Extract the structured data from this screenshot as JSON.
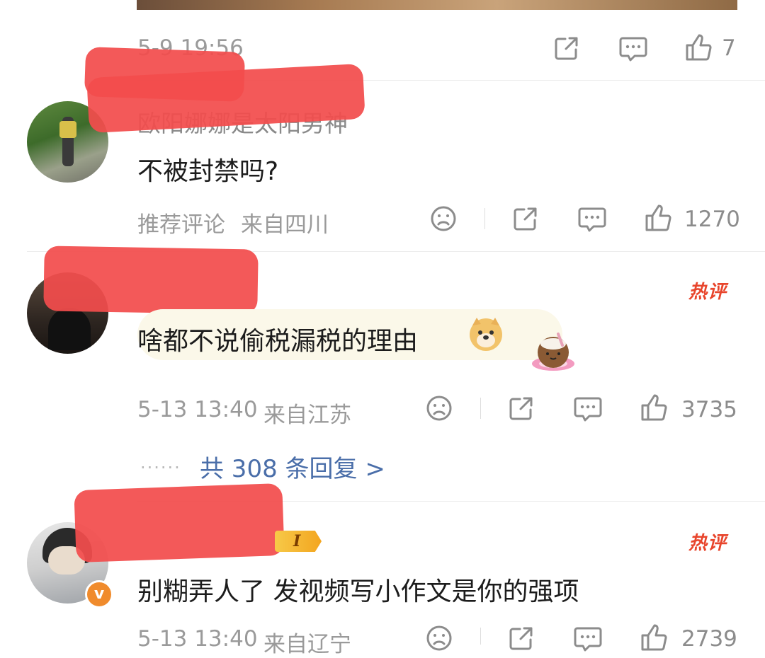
{
  "post": {
    "timestamp": "5-9 19:56",
    "like_count": "7"
  },
  "comments": [
    {
      "username": "欧阳娜娜是太阳男神",
      "text": "不被封禁吗?",
      "tag": "推荐评论",
      "location": "来自四川",
      "like_count": "1270"
    },
    {
      "username": "",
      "text": "啥都不说偷税漏税的理由",
      "hot_label": "热评",
      "timestamp": "5-13 13:40",
      "location": "来自江苏",
      "like_count": "3735",
      "reply_link": "共 308 条回复 >",
      "reply_dots": "......"
    },
    {
      "username": "",
      "badge_label": "I",
      "text": "别糊弄人了 发视频写小作文是你的强项",
      "hot_label": "热评",
      "timestamp": "5-13 13:40",
      "location": "来自辽宁",
      "like_count": "2739"
    }
  ],
  "colors": {
    "accent_link": "#4a6ea9",
    "hot": "#e8452c",
    "verified": "#f08b2c",
    "redaction": "#f24c4c"
  },
  "icons": [
    "share-icon",
    "comment-icon",
    "like-icon",
    "sad-face-icon",
    "doge-emoji-icon",
    "coconut-emoji-icon",
    "verified-v-icon",
    "level-badge-icon"
  ]
}
